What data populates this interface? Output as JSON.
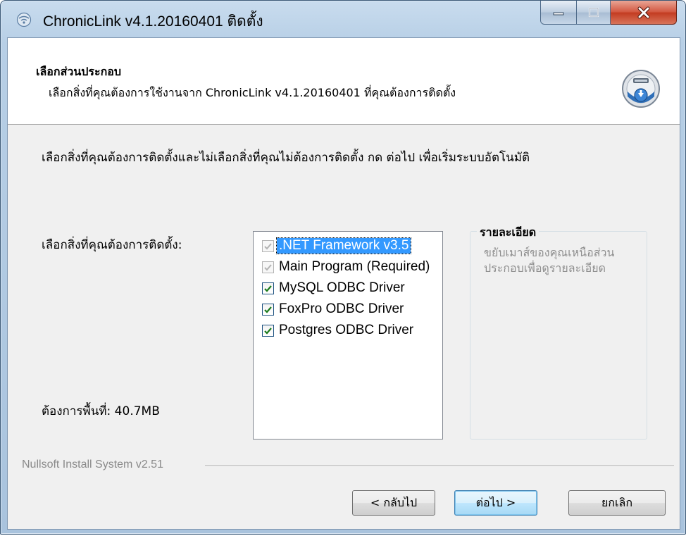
{
  "window": {
    "title": "ChronicLink v4.1.20160401 ติดตั้ง",
    "caption_buttons": {
      "minimize_icon": "minimize-icon",
      "maximize_icon": "maximize-icon",
      "close_icon": "close-icon"
    }
  },
  "header": {
    "title": "เลือกส่วนประกอบ",
    "subtitle": "เลือกสิ่งที่คุณต้องการใช้งานจาก ChronicLink v4.1.20160401 ที่คุณต้องการติดตั้ง",
    "icon": "installer-disc-icon"
  },
  "body": {
    "instruction": "เลือกสิ่งที่คุณต้องการติดตั้งและไม่เลือกสิ่งที่คุณไม่ต้องการติดตั้ง กด ต่อไป เพื่อเริ่มระบบอัตโนมัติ",
    "select_label": "เลือกสิ่งที่คุณต้องการติดตั้ง:",
    "space_required": "ต้องการพื้นที่: 40.7MB"
  },
  "components": [
    {
      "label": ".NET Framework v3.5",
      "checked": true,
      "disabled": true,
      "selected": true
    },
    {
      "label": "Main Program (Required)",
      "checked": true,
      "disabled": true,
      "selected": false
    },
    {
      "label": "MySQL ODBC Driver",
      "checked": true,
      "disabled": false,
      "selected": false
    },
    {
      "label": "FoxPro ODBC Driver",
      "checked": true,
      "disabled": false,
      "selected": false
    },
    {
      "label": "Postgres ODBC Driver",
      "checked": true,
      "disabled": false,
      "selected": false
    }
  ],
  "description": {
    "legend": "รายละเอียด",
    "text": "ขยับเมาส์ของคุณเหนือส่วนประกอบเพื่อดูรายละเอียด"
  },
  "footer": {
    "branding": "Nullsoft Install System v2.51",
    "back_label": "< กลับไป",
    "next_label": "ต่อไป >",
    "cancel_label": "ยกเลิก"
  },
  "colors": {
    "selection": "#3399ff",
    "check_enabled": "#1a7a1a",
    "check_disabled": "#b3b3b3",
    "close_button": "#c23a20"
  }
}
